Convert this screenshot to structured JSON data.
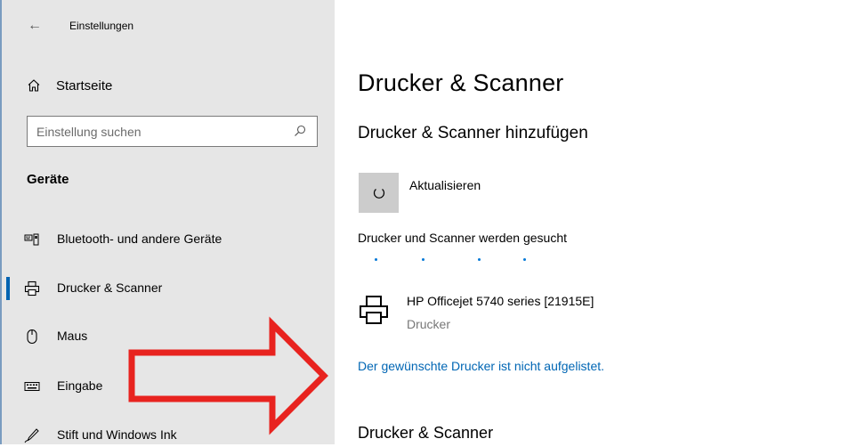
{
  "window": {
    "title": "Einstellungen"
  },
  "sidebar": {
    "home_label": "Startseite",
    "search": {
      "placeholder": "Einstellung suchen",
      "value": ""
    },
    "section_title": "Geräte",
    "items": [
      {
        "label": "Bluetooth- und andere Geräte",
        "icon": "bluetooth-devices-icon",
        "active": false
      },
      {
        "label": "Drucker & Scanner",
        "icon": "printer-icon",
        "active": true
      },
      {
        "label": "Maus",
        "icon": "mouse-icon",
        "active": false
      },
      {
        "label": "Eingabe",
        "icon": "keyboard-icon",
        "active": false
      },
      {
        "label": "Stift und Windows Ink",
        "icon": "pen-icon",
        "active": false
      }
    ]
  },
  "main": {
    "page_title": "Drucker & Scanner",
    "add_heading": "Drucker & Scanner hinzufügen",
    "refresh_label": "Aktualisieren",
    "status_text": "Drucker und Scanner werden gesucht",
    "found_printer": {
      "name": "HP Officejet 5740 series [21915E]",
      "type": "Drucker"
    },
    "not_listed_link": "Der gewünschte Drucker ist nicht aufgelistet.",
    "list_heading": "Drucker & Scanner"
  },
  "colors": {
    "sidebar_bg": "#e6e6e6",
    "accent": "#0063b1",
    "link": "#0066b4",
    "annotation_arrow": "#e8231f"
  }
}
